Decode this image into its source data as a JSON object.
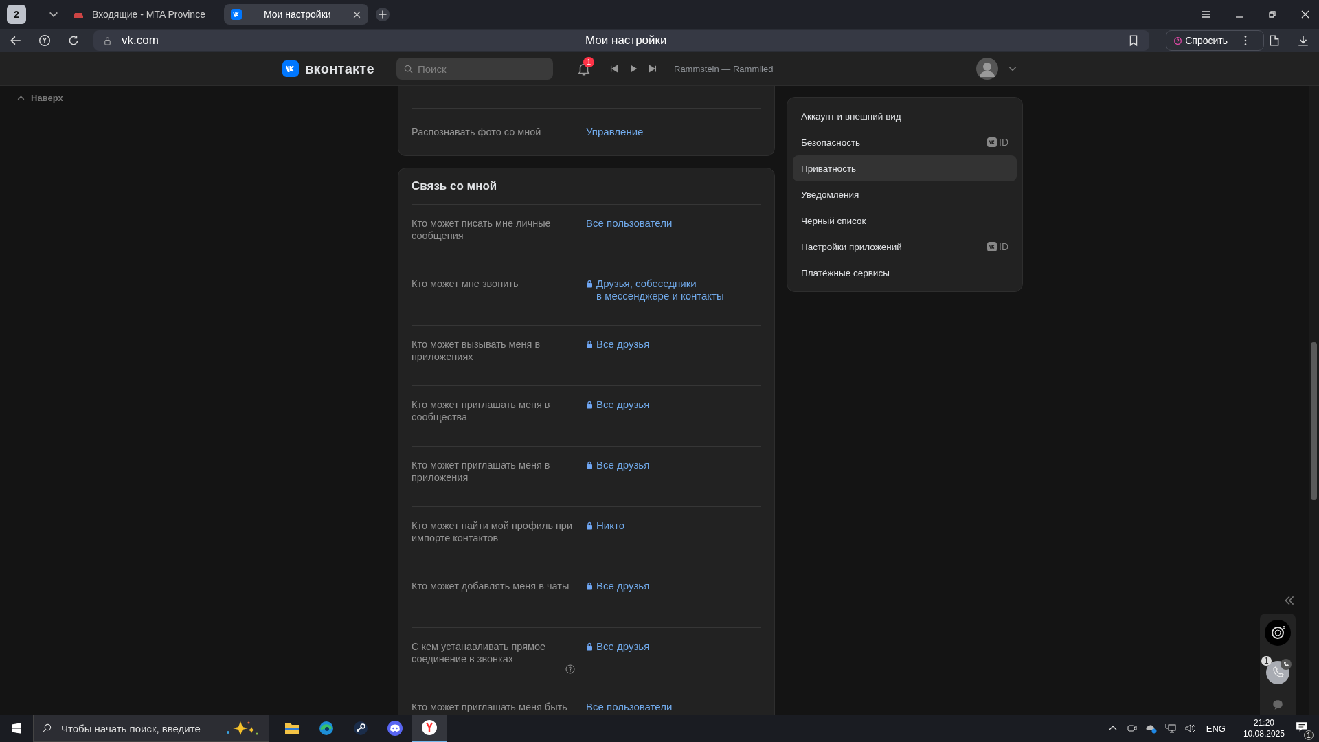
{
  "browser": {
    "tab_count": "2",
    "tabs": [
      {
        "title": "Входящие - MTA Province",
        "selected": false,
        "kind": "car"
      },
      {
        "title": "Мои настройки",
        "selected": true,
        "kind": "vk"
      }
    ],
    "address": "vk.com",
    "page_title": "Мои настройки",
    "ask_button": "Спросить"
  },
  "header": {
    "logo": "вконтакте",
    "search": {
      "placeholder": "Поиск"
    },
    "notifications": "1",
    "track": "Rammstein — Rammlied"
  },
  "back_to_top": "Наверх",
  "cards": [
    {
      "rows": [
        {
          "label": "Распознавать фото со мной",
          "value": "Управление",
          "locked": false,
          "help": false
        }
      ]
    },
    {
      "title": "Связь со мной",
      "rows": [
        {
          "label": "Кто может писать мне личные сообщения",
          "value": "Все пользователи",
          "locked": false,
          "help": false
        },
        {
          "label": "Кто может мне звонить",
          "value": "Друзья, собеседники\nв мессенджере и контакты",
          "locked": true,
          "help": false
        },
        {
          "label": "Кто может вызывать меня в приложениях",
          "value": "Все друзья",
          "locked": true,
          "help": false
        },
        {
          "label": "Кто может приглашать меня в сообщества",
          "value": "Все друзья",
          "locked": true,
          "help": false
        },
        {
          "label": "Кто может приглашать меня в приложения",
          "value": "Все друзья",
          "locked": true,
          "help": false
        },
        {
          "label": "Кто может найти мой профиль при импорте контактов",
          "value": "Никто",
          "locked": true,
          "help": false
        },
        {
          "label": "Кто может добавлять меня в чаты",
          "value": "Все друзья",
          "locked": true,
          "help": false
        },
        {
          "label": "С кем устанавливать прямое соединение в звонках",
          "value": "Все друзья",
          "locked": true,
          "help": true
        },
        {
          "label": "Кто может приглашать меня быть",
          "value": "Все пользователи",
          "locked": false,
          "help": false
        }
      ]
    }
  ],
  "menu": [
    {
      "label": "Аккаунт и внешний вид",
      "selected": false
    },
    {
      "label": "Безопасность",
      "selected": false,
      "badge": "ID"
    },
    {
      "label": "Приватность",
      "selected": true
    },
    {
      "label": "Уведомления",
      "selected": false
    },
    {
      "label": "Чёрный список",
      "selected": false
    },
    {
      "label": "Настройки приложений",
      "selected": false,
      "badge": "ID"
    },
    {
      "label": "Платёжные сервисы",
      "selected": false
    }
  ],
  "widget": {
    "call_badge": "1"
  },
  "taskbar": {
    "search": {
      "placeholder": "Чтобы начать поиск, введите"
    },
    "apps": [
      {
        "kind": "folder",
        "selected": false
      },
      {
        "kind": "edge",
        "selected": false
      },
      {
        "kind": "steam",
        "selected": false
      },
      {
        "kind": "discord",
        "selected": false
      },
      {
        "kind": "yandex",
        "selected": true
      }
    ],
    "language": "ENG",
    "time": "21:20",
    "date": "10.08.2025",
    "notifications": "1"
  }
}
